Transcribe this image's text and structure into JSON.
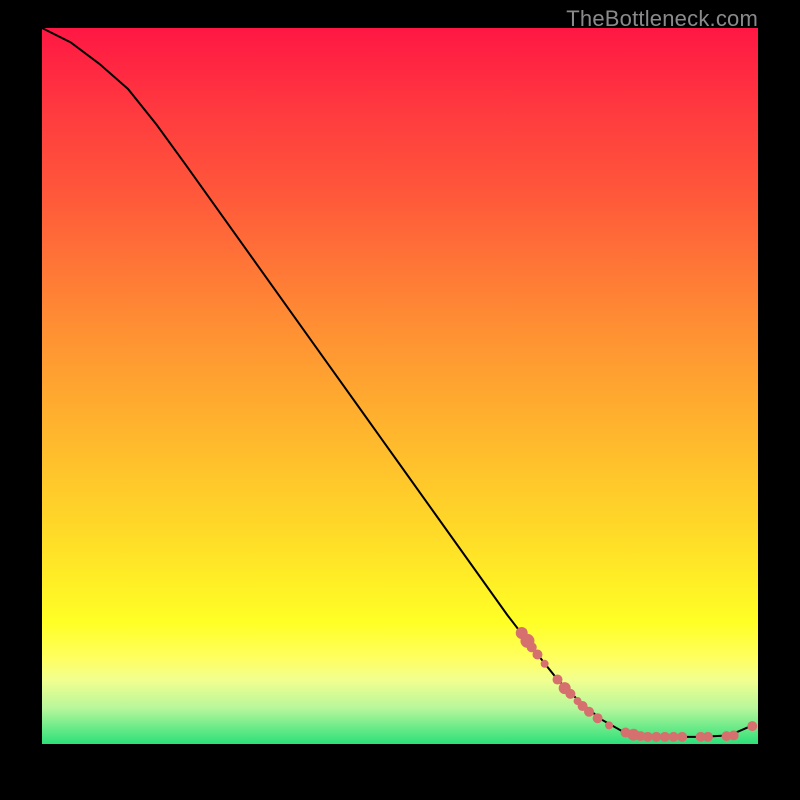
{
  "watermark": "TheBottleneck.com",
  "chart_data": {
    "type": "line",
    "title": "",
    "xlabel": "",
    "ylabel": "",
    "x_range": [
      0,
      100
    ],
    "y_range": [
      0,
      100
    ],
    "grid": false,
    "legend": false,
    "curve": [
      {
        "x": 0.0,
        "y": 100.0
      },
      {
        "x": 4.0,
        "y": 98.0
      },
      {
        "x": 8.0,
        "y": 95.0
      },
      {
        "x": 12.0,
        "y": 91.5
      },
      {
        "x": 16.0,
        "y": 86.5
      },
      {
        "x": 20.0,
        "y": 81.0
      },
      {
        "x": 25.0,
        "y": 74.0
      },
      {
        "x": 30.0,
        "y": 67.0
      },
      {
        "x": 35.0,
        "y": 60.0
      },
      {
        "x": 40.0,
        "y": 53.0
      },
      {
        "x": 45.0,
        "y": 46.0
      },
      {
        "x": 50.0,
        "y": 39.0
      },
      {
        "x": 55.0,
        "y": 32.0
      },
      {
        "x": 60.0,
        "y": 25.0
      },
      {
        "x": 65.0,
        "y": 18.0
      },
      {
        "x": 70.0,
        "y": 11.5
      },
      {
        "x": 72.0,
        "y": 9.0
      },
      {
        "x": 75.0,
        "y": 6.0
      },
      {
        "x": 78.0,
        "y": 3.5
      },
      {
        "x": 81.0,
        "y": 1.8
      },
      {
        "x": 84.0,
        "y": 1.0
      },
      {
        "x": 88.0,
        "y": 1.0
      },
      {
        "x": 92.0,
        "y": 1.0
      },
      {
        "x": 96.0,
        "y": 1.2
      },
      {
        "x": 99.0,
        "y": 2.5
      }
    ],
    "points": [
      {
        "x": 67.0,
        "y": 15.5,
        "r": 6
      },
      {
        "x": 67.8,
        "y": 14.4,
        "r": 7
      },
      {
        "x": 68.4,
        "y": 13.5,
        "r": 5
      },
      {
        "x": 69.2,
        "y": 12.5,
        "r": 5
      },
      {
        "x": 70.2,
        "y": 11.2,
        "r": 4
      },
      {
        "x": 72.0,
        "y": 9.0,
        "r": 5
      },
      {
        "x": 73.0,
        "y": 7.8,
        "r": 6
      },
      {
        "x": 73.8,
        "y": 7.0,
        "r": 5
      },
      {
        "x": 74.8,
        "y": 6.0,
        "r": 4
      },
      {
        "x": 75.5,
        "y": 5.3,
        "r": 5
      },
      {
        "x": 76.4,
        "y": 4.5,
        "r": 5
      },
      {
        "x": 77.6,
        "y": 3.6,
        "r": 5
      },
      {
        "x": 79.2,
        "y": 2.6,
        "r": 4
      },
      {
        "x": 81.5,
        "y": 1.6,
        "r": 5
      },
      {
        "x": 82.6,
        "y": 1.3,
        "r": 6
      },
      {
        "x": 83.6,
        "y": 1.1,
        "r": 5
      },
      {
        "x": 84.6,
        "y": 1.0,
        "r": 5
      },
      {
        "x": 85.8,
        "y": 1.0,
        "r": 5
      },
      {
        "x": 87.0,
        "y": 1.0,
        "r": 5
      },
      {
        "x": 88.2,
        "y": 1.0,
        "r": 5
      },
      {
        "x": 89.4,
        "y": 1.0,
        "r": 5
      },
      {
        "x": 92.0,
        "y": 1.0,
        "r": 5
      },
      {
        "x": 93.0,
        "y": 1.0,
        "r": 5
      },
      {
        "x": 95.6,
        "y": 1.1,
        "r": 5
      },
      {
        "x": 96.6,
        "y": 1.2,
        "r": 5
      },
      {
        "x": 99.2,
        "y": 2.5,
        "r": 5
      }
    ],
    "point_color": "#d6706e",
    "line_color": "#000000"
  }
}
